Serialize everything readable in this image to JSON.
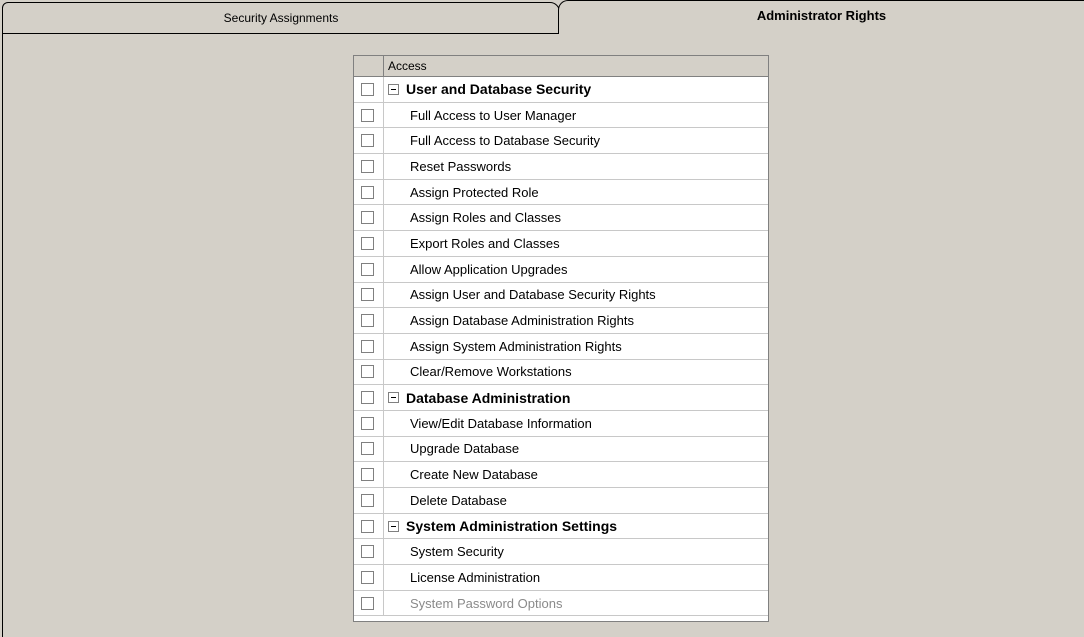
{
  "tabs": {
    "security_assignments": "Security Assignments",
    "administrator_rights": "Administrator Rights"
  },
  "grid": {
    "header": "Access",
    "rows": [
      {
        "label": "User and Database Security",
        "type": "group",
        "checked": false
      },
      {
        "label": "Full Access to User Manager",
        "type": "item",
        "checked": false
      },
      {
        "label": "Full Access to Database Security",
        "type": "item",
        "checked": false
      },
      {
        "label": "Reset Passwords",
        "type": "item",
        "checked": false
      },
      {
        "label": "Assign Protected Role",
        "type": "item",
        "checked": false
      },
      {
        "label": "Assign Roles and Classes",
        "type": "item",
        "checked": false
      },
      {
        "label": "Export Roles and Classes",
        "type": "item",
        "checked": false
      },
      {
        "label": "Allow Application Upgrades",
        "type": "item",
        "checked": false
      },
      {
        "label": "Assign User and Database Security Rights",
        "type": "item",
        "checked": false
      },
      {
        "label": "Assign Database Administration Rights",
        "type": "item",
        "checked": false
      },
      {
        "label": "Assign System Administration Rights",
        "type": "item",
        "checked": false
      },
      {
        "label": "Clear/Remove Workstations",
        "type": "item",
        "checked": false
      },
      {
        "label": "Database Administration",
        "type": "group",
        "checked": false
      },
      {
        "label": "View/Edit Database Information",
        "type": "item",
        "checked": false
      },
      {
        "label": "Upgrade Database",
        "type": "item",
        "checked": false
      },
      {
        "label": "Create New Database",
        "type": "item",
        "checked": false
      },
      {
        "label": "Delete Database",
        "type": "item",
        "checked": false
      },
      {
        "label": "System Administration Settings",
        "type": "group",
        "checked": false
      },
      {
        "label": "System Security",
        "type": "item",
        "checked": false
      },
      {
        "label": "License Administration",
        "type": "item",
        "checked": false
      },
      {
        "label": "System Password Options",
        "type": "item",
        "checked": false,
        "disabled": true
      }
    ]
  }
}
